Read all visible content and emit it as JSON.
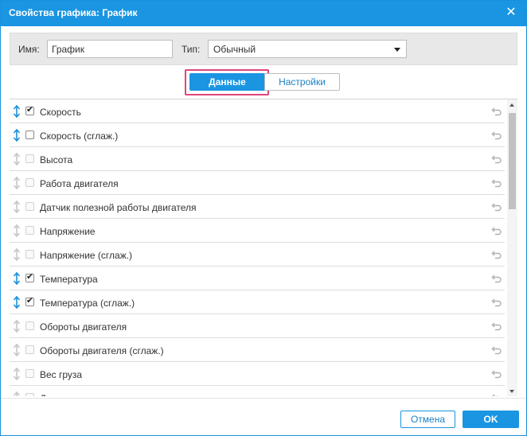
{
  "dialog": {
    "title": "Свойства графика: График",
    "close_icon": "close-icon"
  },
  "properties": {
    "name_label": "Имя:",
    "name_value": "График",
    "type_label": "Тип:",
    "type_value": "Обычный"
  },
  "tabs": [
    {
      "label": "Данные",
      "active": true
    },
    {
      "label": "Настройки",
      "active": false
    }
  ],
  "colors": {
    "accent": "#1a95e2",
    "highlight": "#e0457b",
    "drag_active": "#1a8fdb",
    "drag_inactive": "#c6c6c6"
  },
  "items": [
    {
      "label": "Скорость",
      "checked": true,
      "enabled": true
    },
    {
      "label": "Скорость (сглаж.)",
      "checked": false,
      "enabled": true
    },
    {
      "label": "Высота",
      "checked": false,
      "enabled": false
    },
    {
      "label": "Работа двигателя",
      "checked": false,
      "enabled": false
    },
    {
      "label": "Датчик полезной работы двигателя",
      "checked": false,
      "enabled": false
    },
    {
      "label": "Напряжение",
      "checked": false,
      "enabled": false
    },
    {
      "label": "Напряжение (сглаж.)",
      "checked": false,
      "enabled": false
    },
    {
      "label": "Температура",
      "checked": true,
      "enabled": true
    },
    {
      "label": "Температура (сглаж.)",
      "checked": true,
      "enabled": true
    },
    {
      "label": "Обороты двигателя",
      "checked": false,
      "enabled": false
    },
    {
      "label": "Обороты двигателя (сглаж.)",
      "checked": false,
      "enabled": false
    },
    {
      "label": "Вес груза",
      "checked": false,
      "enabled": false
    },
    {
      "label": "Датчики счетчиков",
      "checked": false,
      "enabled": false
    }
  ],
  "footer": {
    "cancel_label": "Отмена",
    "ok_label": "OK"
  }
}
